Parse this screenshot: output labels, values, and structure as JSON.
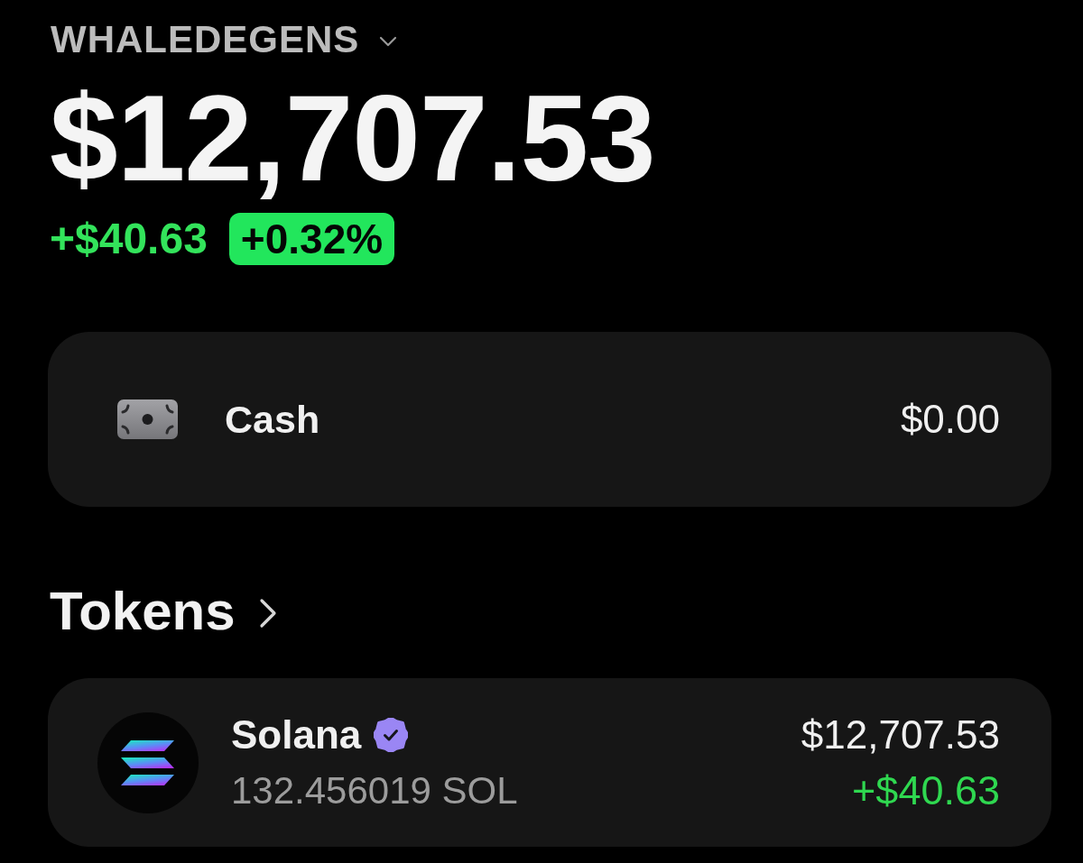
{
  "account": {
    "name": "WHALEDEGENS"
  },
  "balance": {
    "total": "$12,707.53",
    "change": "+$40.63",
    "change_percent": "+0.32%",
    "positive": true
  },
  "cash": {
    "label": "Cash",
    "value": "$0.00"
  },
  "tokens": {
    "title": "Tokens",
    "items": [
      {
        "name": "Solana",
        "verified": true,
        "amount": "132.456019 SOL",
        "value": "$12,707.53",
        "change": "+$40.63",
        "positive": true
      }
    ]
  }
}
